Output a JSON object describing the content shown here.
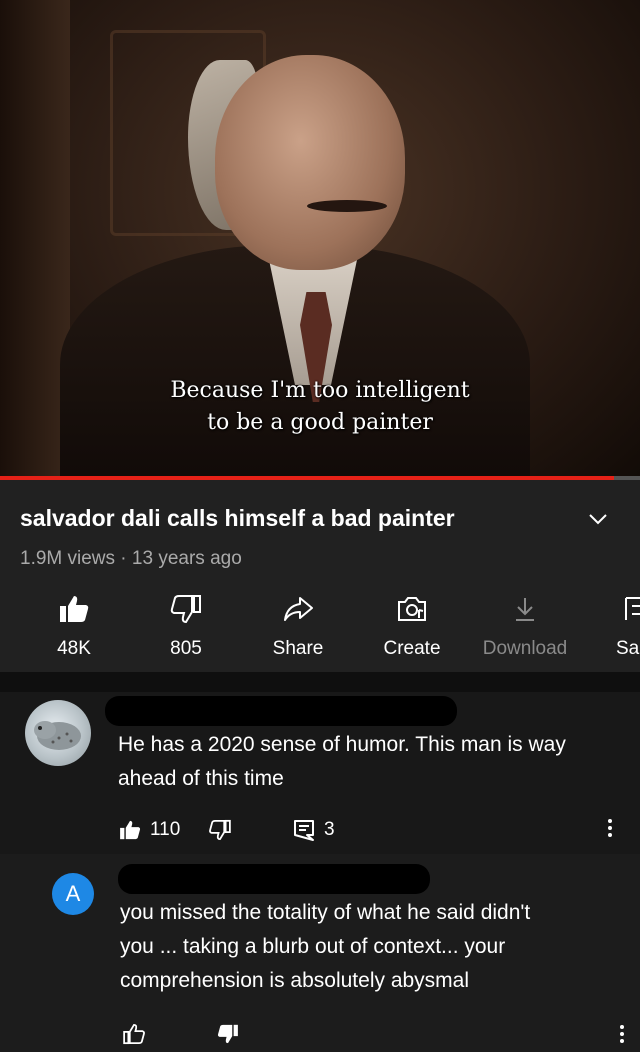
{
  "video": {
    "subtitle_line1": "Because I'm too intelligent",
    "subtitle_line2": "to be a good painter",
    "progress_fraction": 0.96,
    "progress_color": "#e62117"
  },
  "info": {
    "title": "salvador dali calls himself a bad painter",
    "meta": "1.9M views · 13 years ago"
  },
  "actions": [
    {
      "icon": "thumbs-up-filled-icon",
      "label": "48K"
    },
    {
      "icon": "thumbs-down-icon",
      "label": "805"
    },
    {
      "icon": "share-icon",
      "label": "Share"
    },
    {
      "icon": "create-icon",
      "label": "Create"
    },
    {
      "icon": "download-icon",
      "label": "Download"
    },
    {
      "icon": "save-icon",
      "label": "Sa"
    }
  ],
  "comments": [
    {
      "avatar": "seal-photo-avatar",
      "text_line1": "He has a 2020 sense of humor. This man is way",
      "text_line2": "ahead of this time",
      "likes": "110",
      "replies": "3"
    },
    {
      "avatar_letter": "A",
      "avatar_color": "#1e88e5",
      "text_line1": "you missed the totality of what he said didn't",
      "text_line2": "you ... taking a blurb out of context... your",
      "text_line3": "comprehension is absolutely abysmal"
    }
  ]
}
